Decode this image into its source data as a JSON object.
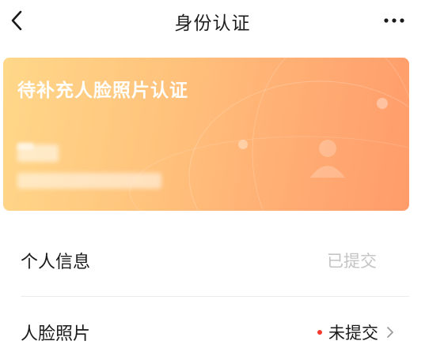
{
  "navbar": {
    "title": "身份认证",
    "back_icon": "chevron-left-icon",
    "more_icon": "more-horizontal-icon"
  },
  "card": {
    "title": "待补充人脸照片认证",
    "colors": {
      "start": "#ffd88a",
      "end": "#ff9c6a"
    }
  },
  "rows": [
    {
      "label": "个人信息",
      "status": "已提交",
      "status_color": "#c4c4c4"
    },
    {
      "label": "人脸照片",
      "status": "未提交",
      "status_color": "#1a1a1a",
      "dot_color": "#f33b2f",
      "chevron_icon": "chevron-right-icon"
    }
  ]
}
